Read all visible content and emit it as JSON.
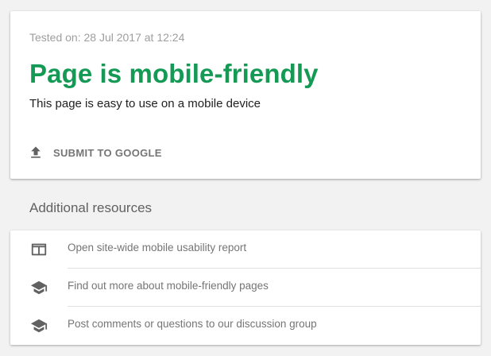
{
  "result": {
    "tested_on": "Tested on: 28 Jul 2017 at 12:24",
    "headline": "Page is mobile-friendly",
    "subtext": "This page is easy to use on a mobile device",
    "submit_label": "SUBMIT TO GOOGLE",
    "accent_color": "#149a55"
  },
  "resources": {
    "title": "Additional resources",
    "items": [
      {
        "label": "Open site-wide mobile usability report",
        "icon": "browser-window-icon"
      },
      {
        "label": "Find out more about mobile-friendly pages",
        "icon": "school-cap-icon"
      },
      {
        "label": "Post comments or questions to our discussion group",
        "icon": "school-cap-icon"
      }
    ]
  }
}
